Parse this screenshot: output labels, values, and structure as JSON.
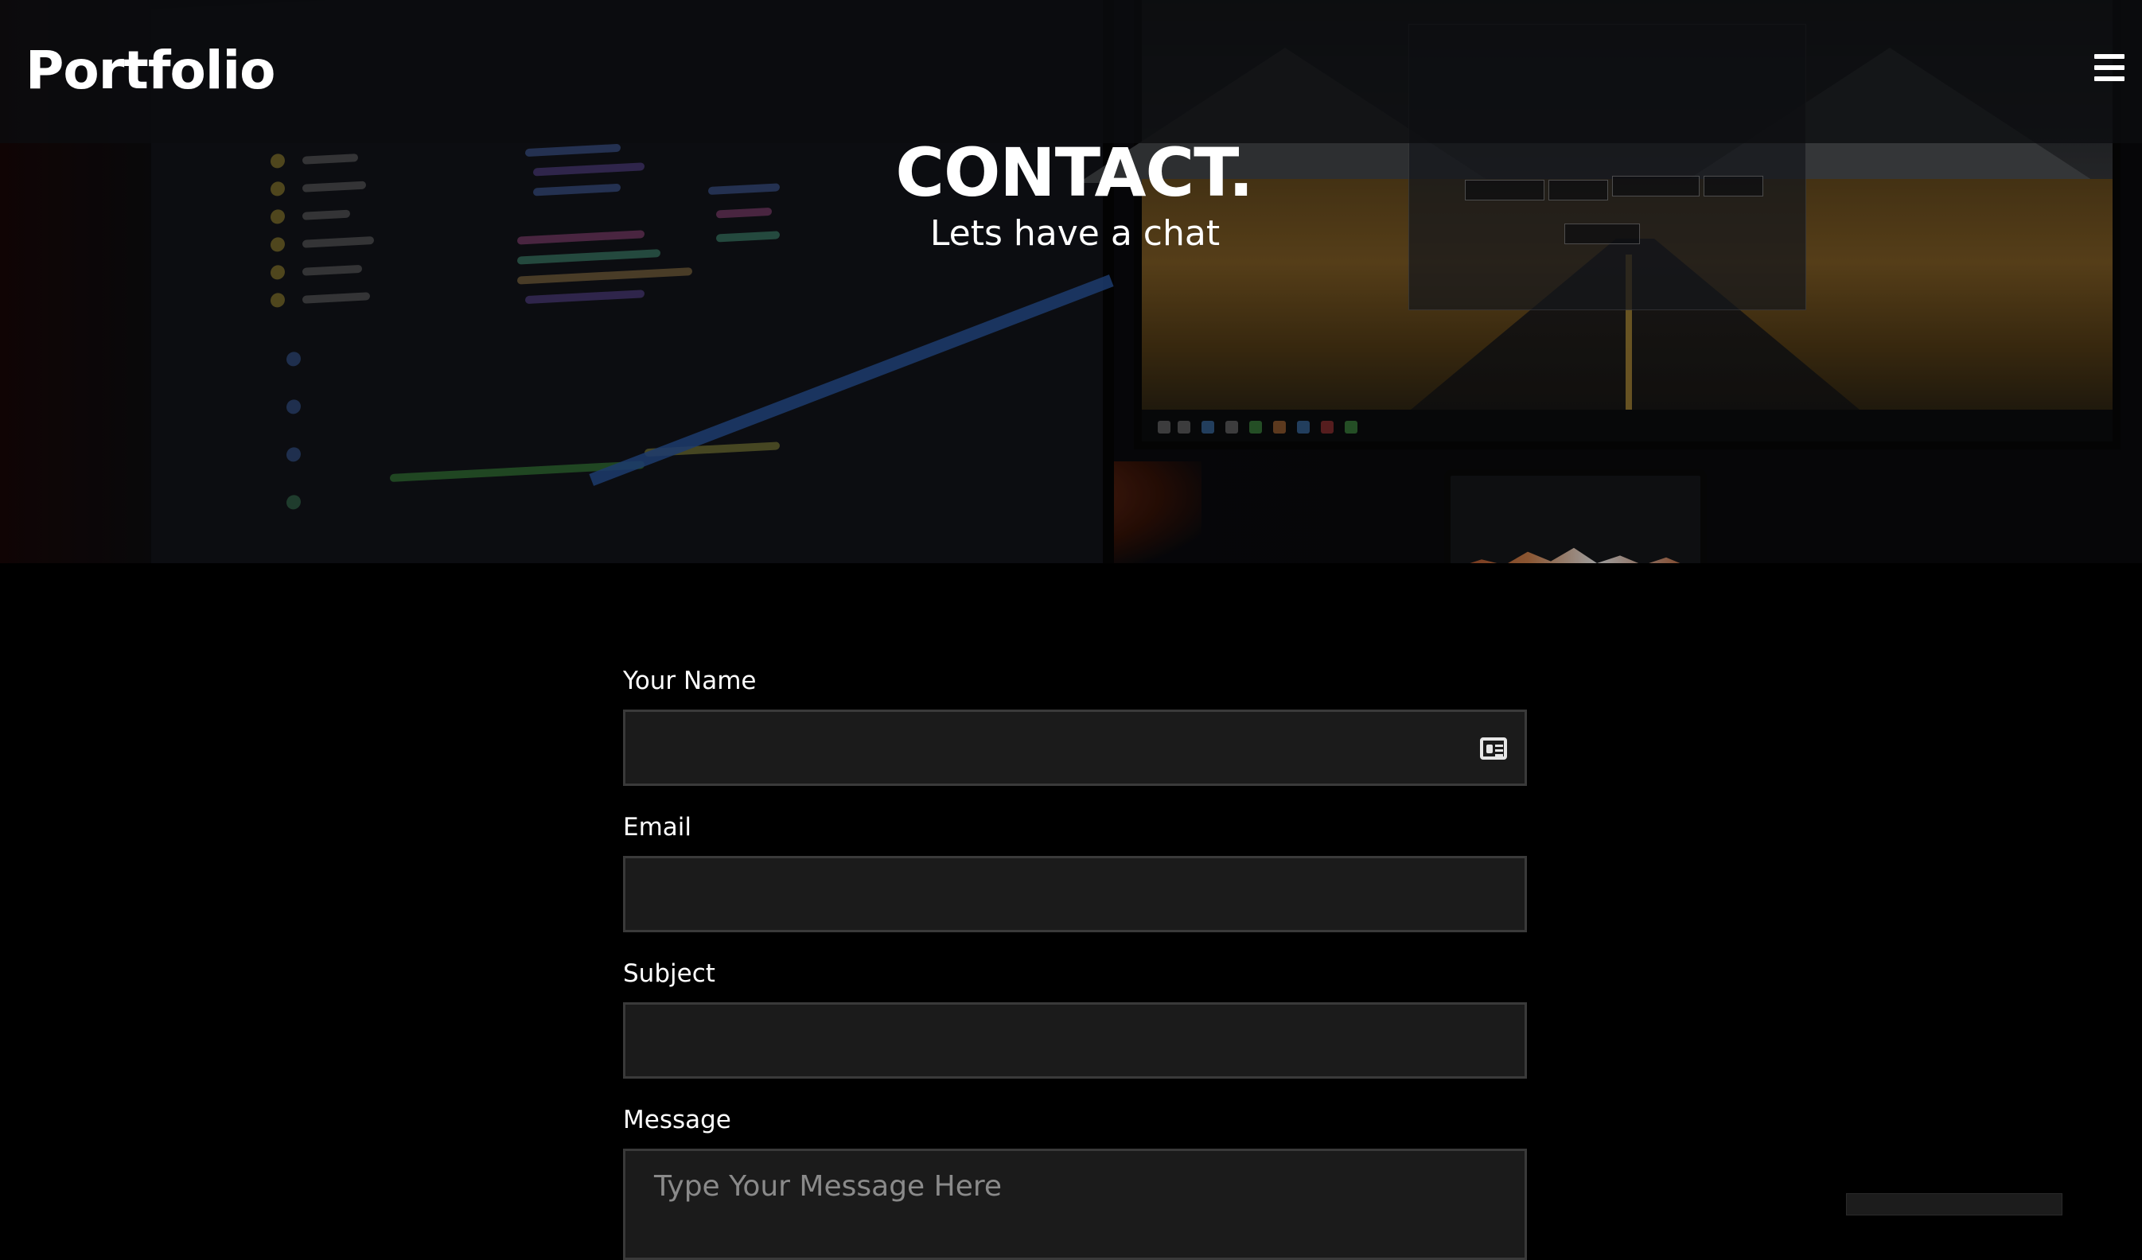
{
  "header": {
    "brand": "Portfolio",
    "menu_icon": "hamburger-menu-icon"
  },
  "hero": {
    "title": "CONTACT.",
    "subtitle": "Lets have a chat"
  },
  "form": {
    "name_label": "Your Name",
    "name_value": "",
    "name_icon": "id-card-icon",
    "email_label": "Email",
    "email_value": "",
    "subject_label": "Subject",
    "subject_value": "",
    "message_label": "Message",
    "message_placeholder": "Type Your Message Here"
  },
  "colors": {
    "background": "#000000",
    "field_bg": "#1b1b1b",
    "field_border": "#3a3a3a",
    "text": "#ffffff",
    "placeholder": "#8a8a8a"
  }
}
